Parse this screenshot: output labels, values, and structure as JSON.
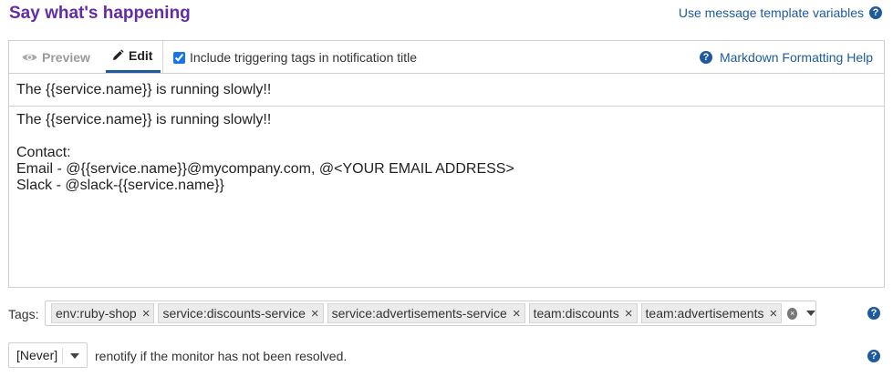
{
  "header": {
    "title": "Say what's happening",
    "template_link": "Use message template variables",
    "help_glyph": "?"
  },
  "editor": {
    "tabs": [
      {
        "label": "Preview",
        "icon": "eye-icon",
        "active": false
      },
      {
        "label": "Edit",
        "icon": "pencil-icon",
        "active": true
      }
    ],
    "include_tags_label": "Include triggering tags in notification title",
    "include_tags_checked": true,
    "markdown_help": "Markdown Formatting Help",
    "title_value": "The {{service.name}} is running slowly!!",
    "body_value": "The {{service.name}} is running slowly!!\n\nContact:\nEmail - @{{service.name}}@mycompany.com, @<YOUR EMAIL ADDRESS>\nSlack - @slack-{{service.name}}"
  },
  "tags": {
    "label": "Tags:",
    "items": [
      "env:ruby-shop",
      "service:discounts-service",
      "service:advertisements-service",
      "team:discounts",
      "team:advertisements"
    ],
    "remove_glyph": "×"
  },
  "renotify": {
    "selected": "[Never]",
    "text": "renotify if the monitor has not been resolved."
  },
  "colors": {
    "title": "#632ca6",
    "link": "#1e5a9e",
    "active_tab_underline": "#1e5a9e"
  }
}
